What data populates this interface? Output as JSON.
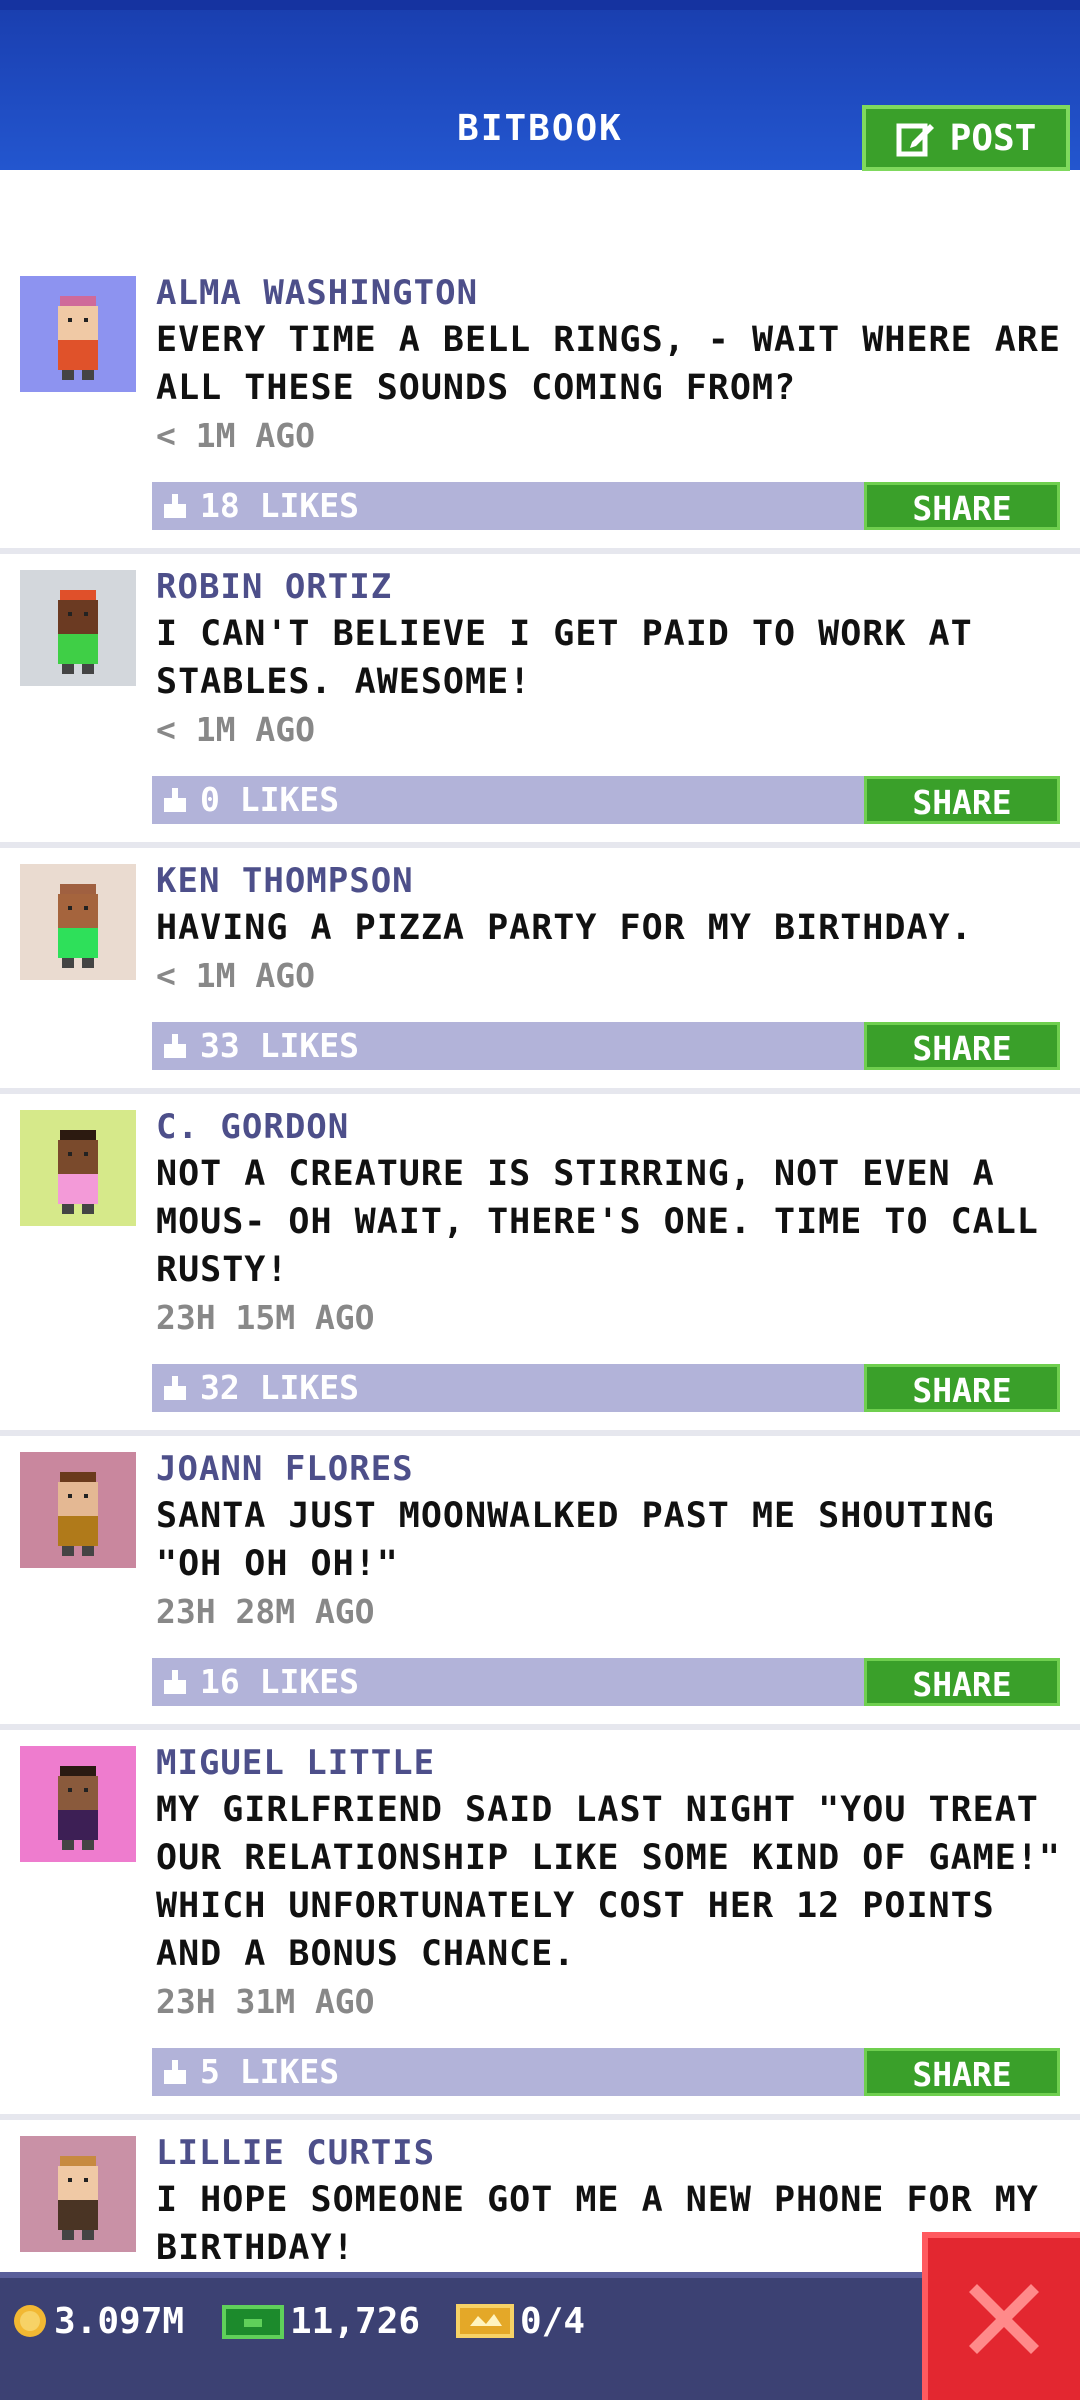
{
  "header": {
    "title": "BITBOOK",
    "post_label": "POST"
  },
  "posts": [
    {
      "author": "ALMA WASHINGTON",
      "text": "EVERY TIME A BELL RINGS, - WAIT WHERE ARE ALL THESE SOUNDS COMING FROM?",
      "time": "< 1M AGO",
      "likes": "18 LIKES",
      "share": "SHARE",
      "avatar_bg": "#8d93f0"
    },
    {
      "author": "ROBIN ORTIZ",
      "text": "I CAN'T BELIEVE I GET PAID TO WORK AT STABLES. AWESOME!",
      "time": "< 1M AGO",
      "likes": "0 LIKES",
      "share": "SHARE",
      "avatar_bg": "#d3d7dc"
    },
    {
      "author": "KEN THOMPSON",
      "text": "HAVING A PIZZA PARTY FOR MY BIRTHDAY.",
      "time": "< 1M AGO",
      "likes": "33 LIKES",
      "share": "SHARE",
      "avatar_bg": "#eadbd0"
    },
    {
      "author": "C. GORDON",
      "text": "NOT A CREATURE IS STIRRING, NOT EVEN A MOUS- OH WAIT, THERE'S ONE. TIME TO CALL RUSTY!",
      "time": "23H 15M AGO",
      "likes": "32 LIKES",
      "share": "SHARE",
      "avatar_bg": "#d6e98a"
    },
    {
      "author": "JOANN FLORES",
      "text": "SANTA JUST MOONWALKED PAST ME SHOUTING \"OH OH OH!\"",
      "time": "23H 28M AGO",
      "likes": "16 LIKES",
      "share": "SHARE",
      "avatar_bg": "#c9879e"
    },
    {
      "author": "MIGUEL LITTLE",
      "text": "MY GIRLFRIEND SAID LAST NIGHT \"YOU TREAT OUR RELATIONSHIP LIKE SOME KIND OF GAME!\" WHICH UNFORTUNATELY COST HER 12 POINTS AND A BONUS CHANCE.",
      "time": "23H 31M AGO",
      "likes": "5 LIKES",
      "share": "SHARE",
      "avatar_bg": "#ee7cce"
    },
    {
      "author": "LILLIE CURTIS",
      "text": "I HOPE SOMEONE GOT ME A NEW PHONE FOR MY BIRTHDAY!",
      "time": "",
      "likes": "",
      "share": "",
      "avatar_bg": "#c991a6"
    }
  ],
  "footer": {
    "coins": "3.097M",
    "bux": "11,726",
    "tickets": "0/4"
  },
  "colors": {
    "header": "#2356cf",
    "share": "#3aa02a",
    "likebar": "#b2b3d9",
    "close": "#e32730"
  },
  "icons": {
    "post": "edit-icon",
    "like": "thumbs-up-icon",
    "coin": "coin-icon",
    "bux": "bux-icon",
    "ticket": "ticket-icon",
    "close": "close-icon"
  }
}
